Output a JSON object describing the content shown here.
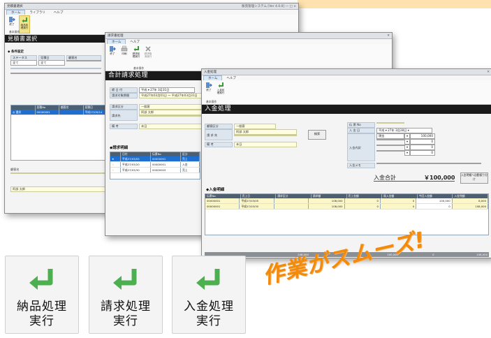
{
  "win1": {
    "title": "見積書選択",
    "system": "販売管理システム [Ver 4.0.0] ― □ ×",
    "menu": [
      "ホーム",
      "ライブラリ",
      "ヘルプ"
    ],
    "buttons": [
      "終了",
      "納品処理実行"
    ],
    "group": "基本操作",
    "header": "見積書選択",
    "filter_label": "◆ 条件設定",
    "filter_cols": [
      "ステータス",
      "見積日",
      "顧客名"
    ],
    "filter_vals": [
      "全て",
      "全て"
    ],
    "grid_headers": [
      "",
      "見積No",
      "顧客名",
      "見積日"
    ],
    "grid_row": [
      "◎ 選択",
      "00000001",
      "",
      "平成27/05/14"
    ],
    "customer_label": "顧客名",
    "customer_value": "阿部 太郎"
  },
  "win2": {
    "title": "請求書処理",
    "menu": [
      "ホーム",
      "ヘルプ"
    ],
    "buttons": [
      "終了",
      "印刷",
      "請求処理実行",
      "請求取消実行"
    ],
    "group": "基本操作",
    "header": "合計請求処理",
    "fields": {
      "date_label": "締 日 付",
      "date_value": "平成 ▾ 27年 3月31日",
      "period_label": "請求対象期間",
      "period_value": "平成27年03月01日 ～ 平成27年03月31日",
      "cust_label": "請求区分",
      "cust_value": "一般客",
      "name_label": "請求先",
      "name_value": "阿部 太郎",
      "note_label": "備 考",
      "note_value": "未日"
    },
    "section": "◆請求明細",
    "grid_headers": [
      "",
      "日付",
      "伝票No",
      "区分"
    ],
    "grid_rows": [
      [
        "★",
        "平成27/03/05",
        "00000001",
        "売上"
      ],
      [
        "☆",
        "平成27/03/20",
        "00000001",
        "入金"
      ],
      [
        "☆",
        "平成27/03/30",
        "00000003",
        "売上"
      ]
    ]
  },
  "win3": {
    "title": "入金処理",
    "menu": [
      "ホーム",
      "ヘルプ"
    ],
    "buttons": [
      "終了",
      "入金処理実行"
    ],
    "group": "基本操作",
    "header": "入金処理",
    "fields": {
      "kind_label": "顧客区分",
      "kind_value": "一般客",
      "cust_label": "請 求 先",
      "cust_value": "阿部 太郎",
      "note_label": "備 考",
      "note_value": "未日",
      "search_button": "検索",
      "no_label": "伝 票 No",
      "date_label": "入 金 日",
      "date_value": "平成 ▾ 27年 3月28日 ▾",
      "detail_label": "入金内訳",
      "detail_rows": [
        [
          "現金",
          "▾",
          "100,000"
        ],
        [
          "",
          "▾",
          "0"
        ],
        [
          "",
          "▾",
          "0"
        ],
        [
          "",
          "▾",
          "0"
        ]
      ],
      "memo_label": "入金メモ"
    },
    "total_label": "入金合計",
    "total_value": "￥100,000",
    "link_label": "入金明細へ自動振り分け",
    "section": "◆入金明細",
    "grid_headers": [
      "伝票No",
      "売上日",
      "請求区分",
      "請求額",
      "売上金額",
      "既入金額",
      "今回入金額",
      "入金残額"
    ],
    "grid_rows": [
      [
        "00000001",
        "平成27/03/05",
        "",
        "108,000",
        "0",
        "0",
        "100,000",
        "8,000"
      ],
      [
        "00000001",
        "平成27/03/30",
        "",
        "108,000",
        "0",
        "0",
        "0",
        "108,000"
      ]
    ],
    "footer_values": [
      "208,000",
      "0",
      "100,000",
      "0",
      "108,000"
    ],
    "footer_label": "請求合計"
  },
  "big_buttons": [
    {
      "l1": "納品処理",
      "l2": "実行"
    },
    {
      "l1": "請求処理",
      "l2": "実行"
    },
    {
      "l1": "入金処理",
      "l2": "実行"
    }
  ],
  "slogan": "作業がスムーズ!",
  "colors": {
    "accent_green": "#4caf50",
    "slogan_orange": "#f28a0c",
    "header_black": "#1a1a1a",
    "selection_blue": "#1f6fd1"
  }
}
